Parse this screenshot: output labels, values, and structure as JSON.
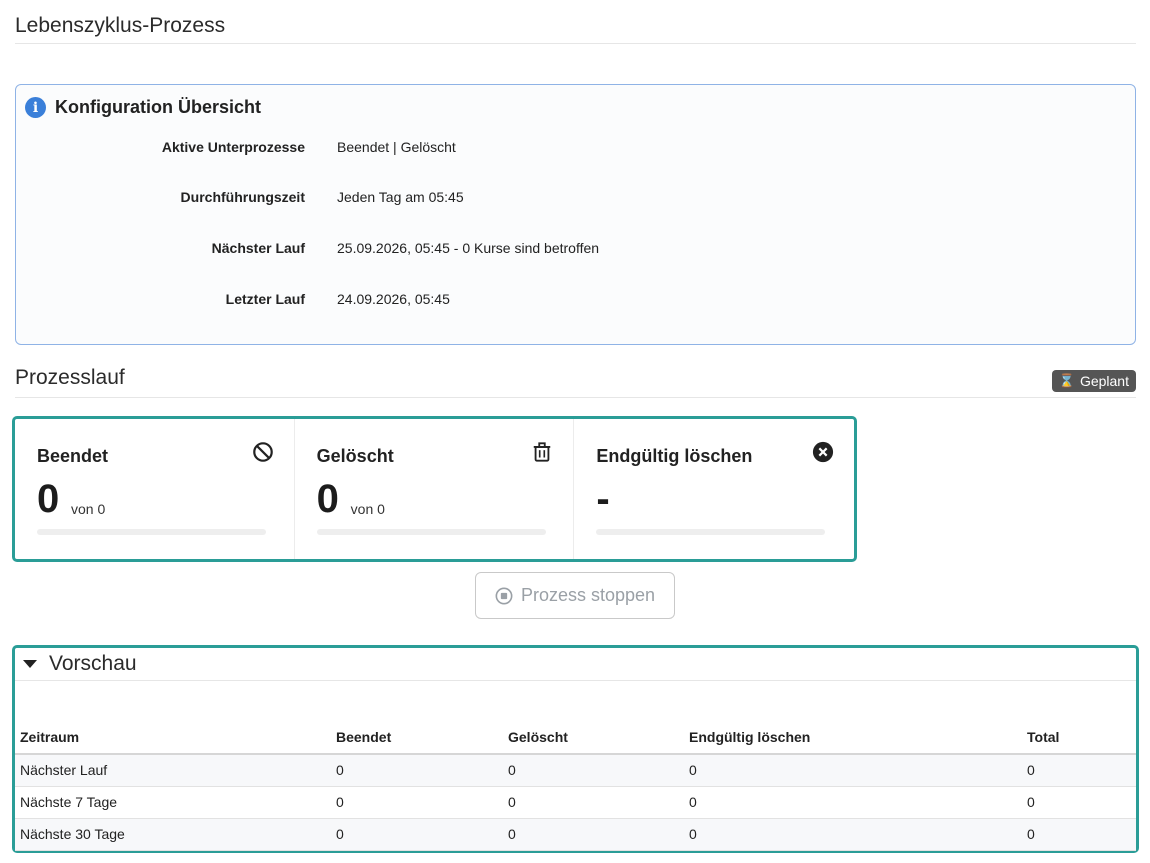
{
  "page_title": "Lebenszyklus-Prozess",
  "config": {
    "title": "Konfiguration Übersicht",
    "icon": "info-icon",
    "rows": [
      {
        "label": "Aktive Unterprozesse",
        "value": "Beendet | Gelöscht"
      },
      {
        "label": "Durchführungszeit",
        "value": "Jeden Tag am 05:45"
      },
      {
        "label": "Nächster Lauf",
        "value": "25.09.2026, 05:45 - 0 Kurse sind betroffen"
      },
      {
        "label": "Letzter Lauf",
        "value": "24.09.2026, 05:45"
      }
    ]
  },
  "process": {
    "title": "Prozesslauf",
    "status_badge": "Geplant",
    "status_icon": "hourglass-icon"
  },
  "cards": [
    {
      "title": "Beendet",
      "value": "0",
      "sub": "von 0",
      "icon": "ban-icon"
    },
    {
      "title": "Gelöscht",
      "value": "0",
      "sub": "von 0",
      "icon": "trash-icon"
    },
    {
      "title": "Endgültig löschen",
      "value": "-",
      "sub": "",
      "icon": "close-circle-icon"
    }
  ],
  "stop_button": {
    "label": "Prozess stoppen",
    "icon": "stop-circle-icon"
  },
  "preview": {
    "title": "Vorschau",
    "columns": [
      "Zeitraum",
      "Beendet",
      "Gelöscht",
      "Endgültig löschen",
      "Total"
    ],
    "rows": [
      [
        "Nächster Lauf",
        "0",
        "0",
        "0",
        "0"
      ],
      [
        "Nächste 7 Tage",
        "0",
        "0",
        "0",
        "0"
      ],
      [
        "Nächste 30 Tage",
        "0",
        "0",
        "0",
        "0"
      ]
    ]
  },
  "colors": {
    "accent": "#2a9d97",
    "info": "#3a7fd9",
    "badge": "#555555"
  }
}
